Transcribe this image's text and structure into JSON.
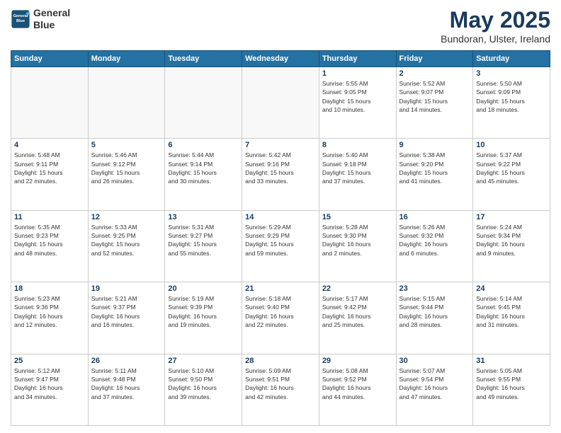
{
  "header": {
    "logo_line1": "General",
    "logo_line2": "Blue",
    "main_title": "May 2025",
    "subtitle": "Bundoran, Ulster, Ireland"
  },
  "days_of_week": [
    "Sunday",
    "Monday",
    "Tuesday",
    "Wednesday",
    "Thursday",
    "Friday",
    "Saturday"
  ],
  "weeks": [
    [
      {
        "num": "",
        "info": ""
      },
      {
        "num": "",
        "info": ""
      },
      {
        "num": "",
        "info": ""
      },
      {
        "num": "",
        "info": ""
      },
      {
        "num": "1",
        "info": "Sunrise: 5:55 AM\nSunset: 9:05 PM\nDaylight: 15 hours\nand 10 minutes."
      },
      {
        "num": "2",
        "info": "Sunrise: 5:52 AM\nSunset: 9:07 PM\nDaylight: 15 hours\nand 14 minutes."
      },
      {
        "num": "3",
        "info": "Sunrise: 5:50 AM\nSunset: 9:09 PM\nDaylight: 15 hours\nand 18 minutes."
      }
    ],
    [
      {
        "num": "4",
        "info": "Sunrise: 5:48 AM\nSunset: 9:11 PM\nDaylight: 15 hours\nand 22 minutes."
      },
      {
        "num": "5",
        "info": "Sunrise: 5:46 AM\nSunset: 9:12 PM\nDaylight: 15 hours\nand 26 minutes."
      },
      {
        "num": "6",
        "info": "Sunrise: 5:44 AM\nSunset: 9:14 PM\nDaylight: 15 hours\nand 30 minutes."
      },
      {
        "num": "7",
        "info": "Sunrise: 5:42 AM\nSunset: 9:16 PM\nDaylight: 15 hours\nand 33 minutes."
      },
      {
        "num": "8",
        "info": "Sunrise: 5:40 AM\nSunset: 9:18 PM\nDaylight: 15 hours\nand 37 minutes."
      },
      {
        "num": "9",
        "info": "Sunrise: 5:38 AM\nSunset: 9:20 PM\nDaylight: 15 hours\nand 41 minutes."
      },
      {
        "num": "10",
        "info": "Sunrise: 5:37 AM\nSunset: 9:22 PM\nDaylight: 15 hours\nand 45 minutes."
      }
    ],
    [
      {
        "num": "11",
        "info": "Sunrise: 5:35 AM\nSunset: 9:23 PM\nDaylight: 15 hours\nand 48 minutes."
      },
      {
        "num": "12",
        "info": "Sunrise: 5:33 AM\nSunset: 9:25 PM\nDaylight: 15 hours\nand 52 minutes."
      },
      {
        "num": "13",
        "info": "Sunrise: 5:31 AM\nSunset: 9:27 PM\nDaylight: 15 hours\nand 55 minutes."
      },
      {
        "num": "14",
        "info": "Sunrise: 5:29 AM\nSunset: 9:29 PM\nDaylight: 15 hours\nand 59 minutes."
      },
      {
        "num": "15",
        "info": "Sunrise: 5:28 AM\nSunset: 9:30 PM\nDaylight: 16 hours\nand 2 minutes."
      },
      {
        "num": "16",
        "info": "Sunrise: 5:26 AM\nSunset: 9:32 PM\nDaylight: 16 hours\nand 6 minutes."
      },
      {
        "num": "17",
        "info": "Sunrise: 5:24 AM\nSunset: 9:34 PM\nDaylight: 16 hours\nand 9 minutes."
      }
    ],
    [
      {
        "num": "18",
        "info": "Sunrise: 5:23 AM\nSunset: 9:36 PM\nDaylight: 16 hours\nand 12 minutes."
      },
      {
        "num": "19",
        "info": "Sunrise: 5:21 AM\nSunset: 9:37 PM\nDaylight: 16 hours\nand 16 minutes."
      },
      {
        "num": "20",
        "info": "Sunrise: 5:19 AM\nSunset: 9:39 PM\nDaylight: 16 hours\nand 19 minutes."
      },
      {
        "num": "21",
        "info": "Sunrise: 5:18 AM\nSunset: 9:40 PM\nDaylight: 16 hours\nand 22 minutes."
      },
      {
        "num": "22",
        "info": "Sunrise: 5:17 AM\nSunset: 9:42 PM\nDaylight: 16 hours\nand 25 minutes."
      },
      {
        "num": "23",
        "info": "Sunrise: 5:15 AM\nSunset: 9:44 PM\nDaylight: 16 hours\nand 28 minutes."
      },
      {
        "num": "24",
        "info": "Sunrise: 5:14 AM\nSunset: 9:45 PM\nDaylight: 16 hours\nand 31 minutes."
      }
    ],
    [
      {
        "num": "25",
        "info": "Sunrise: 5:12 AM\nSunset: 9:47 PM\nDaylight: 16 hours\nand 34 minutes."
      },
      {
        "num": "26",
        "info": "Sunrise: 5:11 AM\nSunset: 9:48 PM\nDaylight: 16 hours\nand 37 minutes."
      },
      {
        "num": "27",
        "info": "Sunrise: 5:10 AM\nSunset: 9:50 PM\nDaylight: 16 hours\nand 39 minutes."
      },
      {
        "num": "28",
        "info": "Sunrise: 5:09 AM\nSunset: 9:51 PM\nDaylight: 16 hours\nand 42 minutes."
      },
      {
        "num": "29",
        "info": "Sunrise: 5:08 AM\nSunset: 9:52 PM\nDaylight: 16 hours\nand 44 minutes."
      },
      {
        "num": "30",
        "info": "Sunrise: 5:07 AM\nSunset: 9:54 PM\nDaylight: 16 hours\nand 47 minutes."
      },
      {
        "num": "31",
        "info": "Sunrise: 5:05 AM\nSunset: 9:55 PM\nDaylight: 16 hours\nand 49 minutes."
      }
    ]
  ]
}
